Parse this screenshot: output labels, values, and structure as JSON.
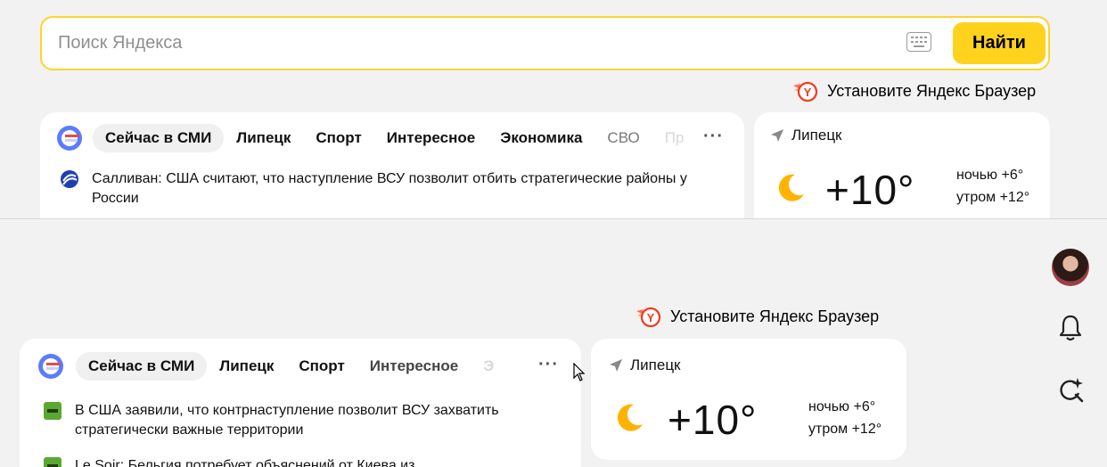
{
  "search": {
    "placeholder": "Поиск Яндекса",
    "keyboard_icon": "keyboard-icon",
    "button_label": "Найти"
  },
  "promo": {
    "text": "Установите Яндекс Браузер",
    "logo_letter": "Y"
  },
  "news_top": {
    "tabs": [
      "Сейчас в СМИ",
      "Липецк",
      "Спорт",
      "Интересное",
      "Экономика",
      "СВО",
      "Пр"
    ],
    "more": "···",
    "items": [
      {
        "text": "Салливан: США считают, что наступление ВСУ позволит отбить стратегические районы у России",
        "source_icon": "globe-source-icon"
      }
    ]
  },
  "news_bottom": {
    "tabs": [
      "Сейчас в СМИ",
      "Липецк",
      "Спорт",
      "Интересное",
      "Э"
    ],
    "more": "···",
    "items": [
      {
        "text": "В США заявили, что контрнаступление позволит ВСУ захватить стратегически важные территории",
        "source_icon": "rt-source-icon"
      },
      {
        "text": "Le Soir: Бельгия потребует объяснений от Киева из",
        "source_icon": "rt-source-icon"
      }
    ]
  },
  "weather": {
    "city": "Липецк",
    "temp": "+10°",
    "night": "ночью +6°",
    "morning": "утром +12°",
    "icon": "moon-icon"
  },
  "colors": {
    "accent": "#ffd21e",
    "border": "#fed42b",
    "background": "#f2f2f2"
  }
}
